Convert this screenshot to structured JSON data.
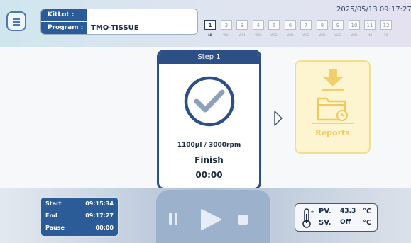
{
  "header": {
    "kitlot_label": "KitLot :",
    "kitlot_value": "",
    "program_label": "Program :",
    "program_value": "TMO-TISSUE",
    "datetime": "2025/05/13 09:17:27"
  },
  "steps": [
    {
      "number": "1",
      "name": "LB",
      "active": true
    },
    {
      "number": "2",
      "name": "WB1",
      "active": false
    },
    {
      "number": "3",
      "name": "WB1",
      "active": false
    },
    {
      "number": "4",
      "name": "WB2",
      "active": false
    },
    {
      "number": "5",
      "name": "WB2",
      "active": false
    },
    {
      "number": "6",
      "name": "WB2",
      "active": false
    },
    {
      "number": "7",
      "name": "WB2",
      "active": false
    },
    {
      "number": "8",
      "name": "WB2",
      "active": false
    },
    {
      "number": "9",
      "name": "WB2",
      "active": false
    },
    {
      "number": "10",
      "name": "WB2",
      "active": false
    },
    {
      "number": "11",
      "name": "MB",
      "active": false
    },
    {
      "number": "12",
      "name": "EB",
      "active": false
    }
  ],
  "step_card": {
    "title": "Step 1",
    "icon": "check-circle-icon",
    "params": "1100μl / 3000rpm",
    "status": "Finish",
    "time": "00:00"
  },
  "reports": {
    "icon": "download-folder-icon",
    "label": "Reports"
  },
  "time_info": {
    "start_label": "Start",
    "start_value": "09:15:34",
    "end_label": "End",
    "end_value": "09:17:27",
    "pause_label": "Pause",
    "pause_value": "00:00"
  },
  "controls": {
    "pause_icon": "pause-icon",
    "play_icon": "play-icon",
    "stop_icon": "stop-icon"
  },
  "temperature": {
    "icon": "thermometer-icon",
    "pv_label": "PV.",
    "pv_value": "43.3",
    "pv_unit": "°C",
    "sv_label": "SV.",
    "sv_value": "Off",
    "sv_unit": "°C"
  },
  "colors": {
    "accent": "#2c4f85",
    "reports_accent": "#efcb6a",
    "card_icon": "#2c4f85"
  }
}
